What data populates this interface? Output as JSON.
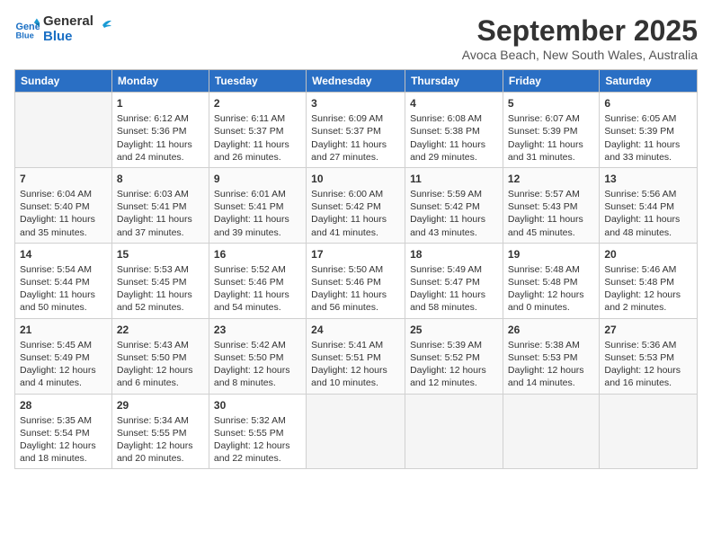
{
  "logo": {
    "text1": "General",
    "text2": "Blue"
  },
  "title": "September 2025",
  "subtitle": "Avoca Beach, New South Wales, Australia",
  "days": [
    "Sunday",
    "Monday",
    "Tuesday",
    "Wednesday",
    "Thursday",
    "Friday",
    "Saturday"
  ],
  "weeks": [
    [
      {
        "date": "",
        "content": ""
      },
      {
        "date": "1",
        "content": "Sunrise: 6:12 AM\nSunset: 5:36 PM\nDaylight: 11 hours\nand 24 minutes."
      },
      {
        "date": "2",
        "content": "Sunrise: 6:11 AM\nSunset: 5:37 PM\nDaylight: 11 hours\nand 26 minutes."
      },
      {
        "date": "3",
        "content": "Sunrise: 6:09 AM\nSunset: 5:37 PM\nDaylight: 11 hours\nand 27 minutes."
      },
      {
        "date": "4",
        "content": "Sunrise: 6:08 AM\nSunset: 5:38 PM\nDaylight: 11 hours\nand 29 minutes."
      },
      {
        "date": "5",
        "content": "Sunrise: 6:07 AM\nSunset: 5:39 PM\nDaylight: 11 hours\nand 31 minutes."
      },
      {
        "date": "6",
        "content": "Sunrise: 6:05 AM\nSunset: 5:39 PM\nDaylight: 11 hours\nand 33 minutes."
      }
    ],
    [
      {
        "date": "7",
        "content": "Sunrise: 6:04 AM\nSunset: 5:40 PM\nDaylight: 11 hours\nand 35 minutes."
      },
      {
        "date": "8",
        "content": "Sunrise: 6:03 AM\nSunset: 5:41 PM\nDaylight: 11 hours\nand 37 minutes."
      },
      {
        "date": "9",
        "content": "Sunrise: 6:01 AM\nSunset: 5:41 PM\nDaylight: 11 hours\nand 39 minutes."
      },
      {
        "date": "10",
        "content": "Sunrise: 6:00 AM\nSunset: 5:42 PM\nDaylight: 11 hours\nand 41 minutes."
      },
      {
        "date": "11",
        "content": "Sunrise: 5:59 AM\nSunset: 5:42 PM\nDaylight: 11 hours\nand 43 minutes."
      },
      {
        "date": "12",
        "content": "Sunrise: 5:57 AM\nSunset: 5:43 PM\nDaylight: 11 hours\nand 45 minutes."
      },
      {
        "date": "13",
        "content": "Sunrise: 5:56 AM\nSunset: 5:44 PM\nDaylight: 11 hours\nand 48 minutes."
      }
    ],
    [
      {
        "date": "14",
        "content": "Sunrise: 5:54 AM\nSunset: 5:44 PM\nDaylight: 11 hours\nand 50 minutes."
      },
      {
        "date": "15",
        "content": "Sunrise: 5:53 AM\nSunset: 5:45 PM\nDaylight: 11 hours\nand 52 minutes."
      },
      {
        "date": "16",
        "content": "Sunrise: 5:52 AM\nSunset: 5:46 PM\nDaylight: 11 hours\nand 54 minutes."
      },
      {
        "date": "17",
        "content": "Sunrise: 5:50 AM\nSunset: 5:46 PM\nDaylight: 11 hours\nand 56 minutes."
      },
      {
        "date": "18",
        "content": "Sunrise: 5:49 AM\nSunset: 5:47 PM\nDaylight: 11 hours\nand 58 minutes."
      },
      {
        "date": "19",
        "content": "Sunrise: 5:48 AM\nSunset: 5:48 PM\nDaylight: 12 hours\nand 0 minutes."
      },
      {
        "date": "20",
        "content": "Sunrise: 5:46 AM\nSunset: 5:48 PM\nDaylight: 12 hours\nand 2 minutes."
      }
    ],
    [
      {
        "date": "21",
        "content": "Sunrise: 5:45 AM\nSunset: 5:49 PM\nDaylight: 12 hours\nand 4 minutes."
      },
      {
        "date": "22",
        "content": "Sunrise: 5:43 AM\nSunset: 5:50 PM\nDaylight: 12 hours\nand 6 minutes."
      },
      {
        "date": "23",
        "content": "Sunrise: 5:42 AM\nSunset: 5:50 PM\nDaylight: 12 hours\nand 8 minutes."
      },
      {
        "date": "24",
        "content": "Sunrise: 5:41 AM\nSunset: 5:51 PM\nDaylight: 12 hours\nand 10 minutes."
      },
      {
        "date": "25",
        "content": "Sunrise: 5:39 AM\nSunset: 5:52 PM\nDaylight: 12 hours\nand 12 minutes."
      },
      {
        "date": "26",
        "content": "Sunrise: 5:38 AM\nSunset: 5:53 PM\nDaylight: 12 hours\nand 14 minutes."
      },
      {
        "date": "27",
        "content": "Sunrise: 5:36 AM\nSunset: 5:53 PM\nDaylight: 12 hours\nand 16 minutes."
      }
    ],
    [
      {
        "date": "28",
        "content": "Sunrise: 5:35 AM\nSunset: 5:54 PM\nDaylight: 12 hours\nand 18 minutes."
      },
      {
        "date": "29",
        "content": "Sunrise: 5:34 AM\nSunset: 5:55 PM\nDaylight: 12 hours\nand 20 minutes."
      },
      {
        "date": "30",
        "content": "Sunrise: 5:32 AM\nSunset: 5:55 PM\nDaylight: 12 hours\nand 22 minutes."
      },
      {
        "date": "",
        "content": ""
      },
      {
        "date": "",
        "content": ""
      },
      {
        "date": "",
        "content": ""
      },
      {
        "date": "",
        "content": ""
      }
    ]
  ]
}
